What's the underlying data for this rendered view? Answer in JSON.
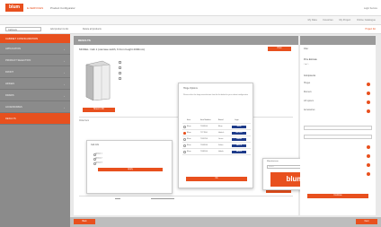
{
  "header": {
    "logo": "blum",
    "brand": "E-SERVICES",
    "product": "Product Configurator",
    "right_text": "Login Service"
  },
  "subbar": {
    "links": [
      "My Data",
      "Favorites",
      "My Project",
      "Online Catalogue"
    ]
  },
  "tabbar": {
    "select_value": "Cabinets",
    "tabs": [
      "Add product to list",
      "Delete all products"
    ],
    "right": "Project list"
  },
  "sidebar": {
    "head": "CABINET CONFIGURATION",
    "items": [
      {
        "label": "APPLICATION",
        "active": false
      },
      {
        "label": "PRODUCT SELECTION",
        "active": false
      },
      {
        "label": "FRONT",
        "active": false
      },
      {
        "label": "HINGES",
        "active": false
      },
      {
        "label": "DRAWS",
        "active": false
      },
      {
        "label": "ACCESSORIES",
        "active": false
      },
      {
        "label": "RESULTS",
        "active": true
      }
    ]
  },
  "main": {
    "head": "RESULTS",
    "title": "MODEL: Cab 1 (carcase width, ft from height 2000mm)",
    "top_button": "Print",
    "image_button": "Show in 3D",
    "list_label": "Order Item",
    "order_button": "Add to order"
  },
  "dialog": {
    "title": "Hinge Options",
    "desc": "Please select the hinge manufacturer from the list below for your cabinet configuration",
    "columns": [
      "Item",
      "Item Number",
      "Brand",
      "Logo"
    ],
    "rows": [
      {
        "item": "Blum",
        "number": "71B3550",
        "brand": "Blum",
        "logo": "BLUM",
        "selected": false
      },
      {
        "item": "Blum",
        "number": "71T3550",
        "brand": "Hettich",
        "logo": "HETTICH",
        "selected": true
      },
      {
        "item": "Blum",
        "number": "71B3750",
        "brand": "Grass",
        "logo": "GRASS",
        "selected": false
      },
      {
        "item": "Blum",
        "number": "71B3590",
        "brand": "Salice",
        "logo": "SALICE",
        "selected": false
      },
      {
        "item": "Blum",
        "number": "71B9550",
        "brand": "Hafele",
        "logo": "HAFELE",
        "selected": false
      }
    ],
    "button": "Ok"
  },
  "subdialog": {
    "title": "Cab Info",
    "button": "Apply",
    "rows": [
      "Option 1",
      "Option 2",
      "Option 3"
    ]
  },
  "blumpop": {
    "title": "Manufacturer",
    "input_placeholder": "Search",
    "logo": "blum"
  },
  "rpanel": {
    "title": "Filter",
    "section1": "Price Estimate",
    "section2": "Components",
    "rows": [
      "Hinges",
      "Runners",
      "Lift system",
      "Accessories"
    ],
    "button": "Continue"
  },
  "bottom": {
    "back": "Back",
    "next": "Next"
  },
  "colors": {
    "accent": "#e8501e",
    "sidebar": "#8b8b8b",
    "panel_head": "#9a9a9a"
  }
}
